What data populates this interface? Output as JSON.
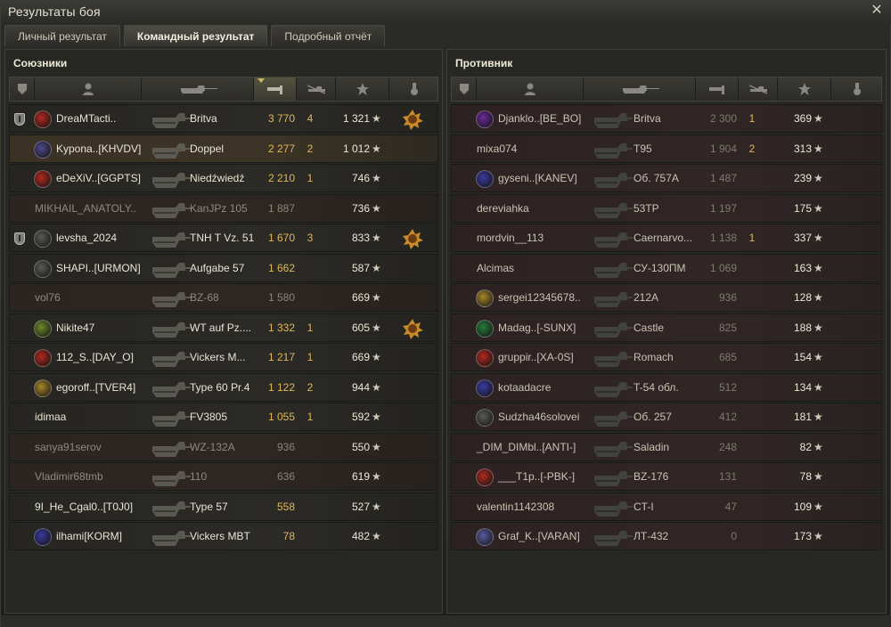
{
  "window": {
    "title": "Результаты боя",
    "close": "✕"
  },
  "tabs": [
    {
      "label": "Личный результат",
      "active": false
    },
    {
      "label": "Командный результат",
      "active": true
    },
    {
      "label": "Подробный отчёт",
      "active": false
    }
  ],
  "allies": {
    "title": "Союзники",
    "columns": [
      "platoon-icon",
      "player-icon",
      "vehicle-icon",
      "damage-icon",
      "frags-icon",
      "xp-icon",
      "medal-icon"
    ],
    "rows": [
      {
        "name": "DreaMTacti..",
        "platoon": true,
        "clan": "#b02a20",
        "vehicle": "Britva",
        "damage": "3 770",
        "frags": "4",
        "xp": "1 321",
        "medal": "2",
        "state": "normal"
      },
      {
        "name": "Kypona..[KHVDV]",
        "platoon": false,
        "clan": "#4e4b8a",
        "vehicle": "Doppel",
        "damage": "2 277",
        "frags": "2",
        "xp": "1 012",
        "medal": "",
        "state": "hl"
      },
      {
        "name": "eDeXiV..[GGPTS]",
        "platoon": false,
        "clan": "#b02a20",
        "vehicle": "Niedźwiedź",
        "damage": "2 210",
        "frags": "1",
        "xp": "746",
        "medal": "",
        "state": "normal"
      },
      {
        "name": "MIKHAIL_ANATOLY..",
        "platoon": false,
        "clan": "",
        "vehicle": "KanJPz 105",
        "damage": "1 887",
        "frags": "",
        "xp": "736",
        "medal": "",
        "state": "dead"
      },
      {
        "name": "levsha_2024",
        "platoon": true,
        "clan": "#5a5a55",
        "vehicle": "TNH T Vz. 51",
        "damage": "1 670",
        "frags": "3",
        "xp": "833",
        "medal": "1",
        "state": "normal"
      },
      {
        "name": "SHAPI..[URMON]",
        "platoon": false,
        "clan": "#5a5a55",
        "vehicle": "Aufgabe 57",
        "damage": "1 662",
        "frags": "",
        "xp": "587",
        "medal": "",
        "state": "normal"
      },
      {
        "name": "vol76",
        "platoon": false,
        "clan": "",
        "vehicle": "BZ-68",
        "damage": "1 580",
        "frags": "",
        "xp": "669",
        "medal": "",
        "state": "dead"
      },
      {
        "name": "Nikite47",
        "platoon": false,
        "clan": "#6b8a2a",
        "vehicle": "WT auf Pz....",
        "damage": "1 332",
        "frags": "1",
        "xp": "605",
        "medal": "1",
        "state": "normal"
      },
      {
        "name": "112_S..[DAY_O]",
        "platoon": false,
        "clan": "#b02a20",
        "vehicle": "Vickers M...",
        "damage": "1 217",
        "frags": "1",
        "xp": "669",
        "medal": "",
        "state": "normal"
      },
      {
        "name": "egoroff..[TVER4]",
        "platoon": false,
        "clan": "#a8862a",
        "vehicle": "Type 60 Pr.4",
        "damage": "1 122",
        "frags": "2",
        "xp": "944",
        "medal": "",
        "state": "normal"
      },
      {
        "name": "idimaa",
        "platoon": false,
        "clan": "",
        "vehicle": "FV3805",
        "damage": "1 055",
        "frags": "1",
        "xp": "592",
        "medal": "",
        "state": "normal"
      },
      {
        "name": "sanya91serov",
        "platoon": false,
        "clan": "",
        "vehicle": "WZ-132A",
        "damage": "936",
        "frags": "",
        "xp": "550",
        "medal": "",
        "state": "dead"
      },
      {
        "name": "Vladimir68tmb",
        "platoon": false,
        "clan": "",
        "vehicle": "110",
        "damage": "636",
        "frags": "",
        "xp": "619",
        "medal": "",
        "state": "dead"
      },
      {
        "name": "9I_He_Cgal0..[T0J0]",
        "platoon": false,
        "clan": "",
        "vehicle": "Type 57",
        "damage": "558",
        "frags": "",
        "xp": "527",
        "medal": "",
        "state": "normal"
      },
      {
        "name": "ilhami[KORM]",
        "platoon": false,
        "clan": "#3a3aa0",
        "vehicle": "Vickers MBT",
        "damage": "78",
        "frags": "",
        "xp": "482",
        "medal": "",
        "state": "normal"
      }
    ]
  },
  "enemies": {
    "title": "Противник",
    "rows": [
      {
        "name": "Djanklo..[BE_BO]",
        "clan": "#6a2a9a",
        "vehicle": "Britva",
        "damage": "2 300",
        "frags": "1",
        "xp": "369"
      },
      {
        "name": "mixa074",
        "clan": "",
        "vehicle": "T95",
        "damage": "1 904",
        "frags": "2",
        "xp": "313"
      },
      {
        "name": "gyseni..[KANEV]",
        "clan": "#3a3aa0",
        "vehicle": "Об. 757А",
        "damage": "1 487",
        "frags": "",
        "xp": "239"
      },
      {
        "name": "dereviahka",
        "clan": "",
        "vehicle": "53TP",
        "damage": "1 197",
        "frags": "",
        "xp": "175"
      },
      {
        "name": "mordvin__113",
        "clan": "",
        "vehicle": "Caernarvo...",
        "damage": "1 138",
        "frags": "1",
        "xp": "337"
      },
      {
        "name": "Alcimas",
        "clan": "",
        "vehicle": "СУ-130ПМ",
        "damage": "1 069",
        "frags": "",
        "xp": "163"
      },
      {
        "name": "sergei12345678..",
        "clan": "#a8862a",
        "vehicle": "212A",
        "damage": "936",
        "frags": "",
        "xp": "128"
      },
      {
        "name": "Madag..[-SUNX]",
        "clan": "#2a7a3a",
        "vehicle": "Castle",
        "damage": "825",
        "frags": "",
        "xp": "188"
      },
      {
        "name": "gruppir..[XA-0S]",
        "clan": "#b02a20",
        "vehicle": "Romach",
        "damage": "685",
        "frags": "",
        "xp": "154"
      },
      {
        "name": "kotaadacre",
        "clan": "#3a3aa0",
        "vehicle": "T-54 обл.",
        "damage": "512",
        "frags": "",
        "xp": "134"
      },
      {
        "name": "Sudzha46solovei",
        "clan": "#5a5a55",
        "vehicle": "Об. 257",
        "damage": "412",
        "frags": "",
        "xp": "181"
      },
      {
        "name": "_DIM_DIMbl..[ANTI-]",
        "clan": "",
        "vehicle": "Saladin",
        "damage": "248",
        "frags": "",
        "xp": "82"
      },
      {
        "name": "___T1p..[-PBK-]",
        "clan": "#b02a20",
        "vehicle": "BZ-176",
        "damage": "131",
        "frags": "",
        "xp": "78"
      },
      {
        "name": "valentin1142308",
        "clan": "",
        "vehicle": "CT-I",
        "damage": "47",
        "frags": "",
        "xp": "109"
      },
      {
        "name": "Graf_K..[VARAN]",
        "clan": "#5a5aa0",
        "vehicle": "ЛТ-432",
        "damage": "0",
        "frags": "",
        "xp": "173"
      }
    ]
  },
  "star_glyph": "★"
}
